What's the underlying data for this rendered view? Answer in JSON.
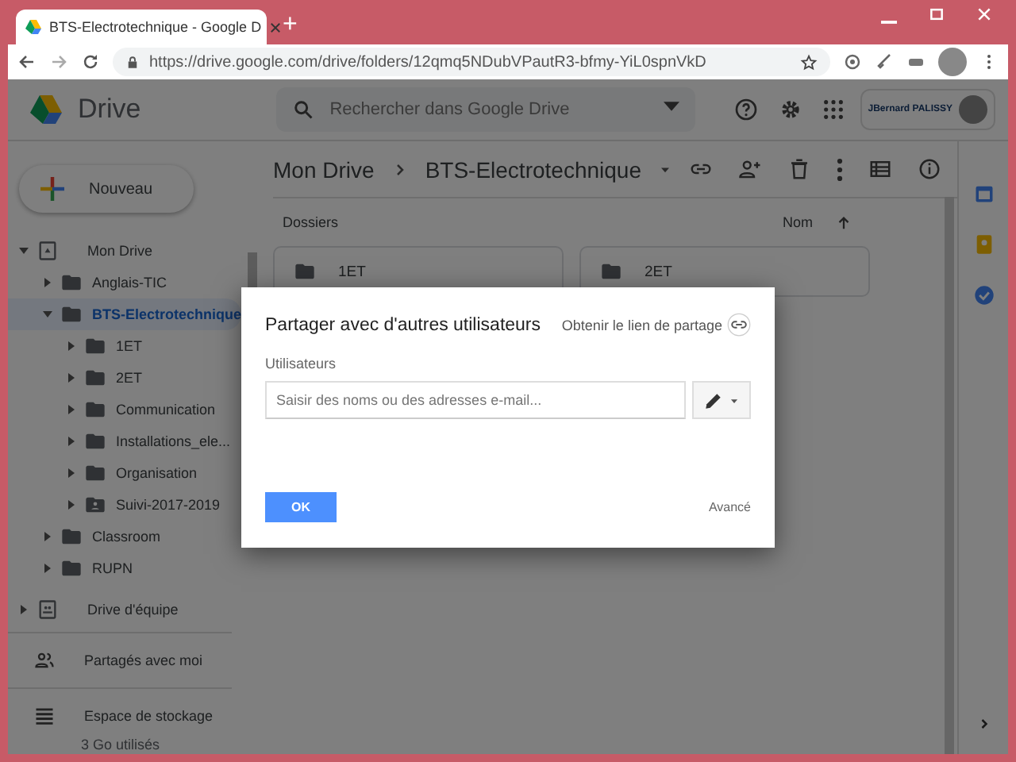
{
  "browser": {
    "tab_title": "BTS-Electrotechnique - Google D",
    "new_tab": "+",
    "url": "https://drive.google.com/drive/folders/12qmq5NDubVPautR3-bfmy-YiL0spnVkD"
  },
  "header": {
    "app_name": "Drive",
    "search": {
      "placeholder": "Rechercher dans Google Drive"
    },
    "account_logo": "JBernard PALISSY"
  },
  "sidebar": {
    "new_button": "Nouveau",
    "tree": [
      {
        "label": "Mon Drive",
        "kind": "drive",
        "expanded": true,
        "selected": false,
        "children": [
          {
            "label": "Anglais-TIC",
            "kind": "folder",
            "expanded": false,
            "selected": false
          },
          {
            "label": "BTS-Electrotechnique",
            "kind": "folder",
            "expanded": true,
            "selected": true,
            "children": [
              {
                "label": "1ET",
                "kind": "folder",
                "expanded": false,
                "selected": false
              },
              {
                "label": "2ET",
                "kind": "folder",
                "expanded": false,
                "selected": false
              },
              {
                "label": "Communication",
                "kind": "folder",
                "expanded": false,
                "selected": false
              },
              {
                "label": "Installations_ele...",
                "kind": "folder",
                "expanded": false,
                "selected": false
              },
              {
                "label": "Organisation",
                "kind": "folder",
                "expanded": false,
                "selected": false
              },
              {
                "label": "Suivi-2017-2019",
                "kind": "shared_folder",
                "expanded": false,
                "selected": false
              }
            ]
          },
          {
            "label": "Classroom",
            "kind": "folder",
            "expanded": false,
            "selected": false
          },
          {
            "label": "RUPN",
            "kind": "folder",
            "expanded": false,
            "selected": false
          }
        ]
      },
      {
        "label": "Drive d'équipe",
        "kind": "team_drive",
        "expanded": false,
        "selected": false
      }
    ],
    "shared": "Partagés avec moi",
    "storage": {
      "label": "Espace de stockage",
      "usage": "3 Go utilisés"
    }
  },
  "main": {
    "breadcrumb": [
      "Mon Drive",
      "BTS-Electrotechnique"
    ],
    "section": "Dossiers",
    "sort": "Nom",
    "folders": [
      {
        "name": "1ET"
      },
      {
        "name": "2ET"
      }
    ]
  },
  "dialog": {
    "title": "Partager avec d'autres utilisateurs",
    "share_link": "Obtenir le lien de partage",
    "users_label": "Utilisateurs",
    "input": {
      "placeholder": "Saisir des noms ou des adresses e-mail..."
    },
    "ok": "OK",
    "advanced": "Avancé"
  }
}
